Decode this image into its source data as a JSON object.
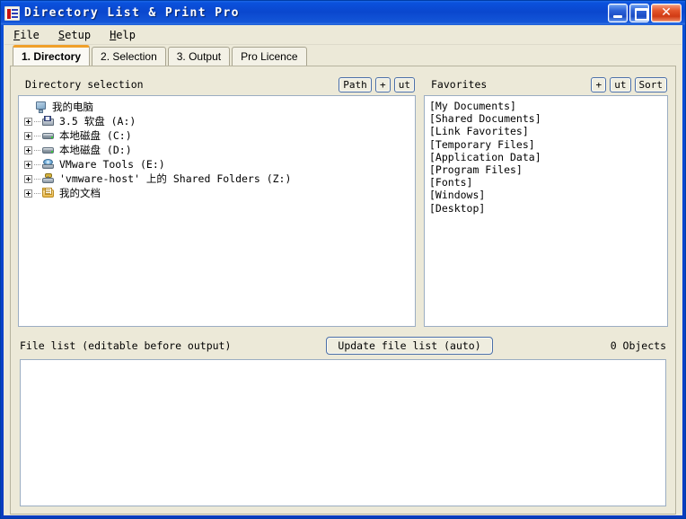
{
  "window": {
    "title": "Directory List & Print Pro",
    "icon": "app-list-icon",
    "minimize_label": "_",
    "maximize_label": "□",
    "close_label": "✕"
  },
  "menu": {
    "items": [
      {
        "accel": "F",
        "rest": "ile"
      },
      {
        "accel": "S",
        "rest": "etup"
      },
      {
        "accel": "H",
        "rest": "elp"
      }
    ]
  },
  "tabs": [
    {
      "label": "1. Directory",
      "active": true
    },
    {
      "label": "2. Selection",
      "active": false
    },
    {
      "label": "3. Output",
      "active": false
    },
    {
      "label": "Pro Licence",
      "active": false
    }
  ],
  "directory_panel": {
    "title": "Directory selection",
    "buttons": [
      {
        "label": "Path",
        "name": "path-button"
      },
      {
        "label": "+",
        "name": "add-button"
      },
      {
        "label": "ut",
        "name": "cut-button"
      }
    ],
    "tree": [
      {
        "label": "我的电脑",
        "icon": "computer-icon",
        "expander": false,
        "indent": 0
      },
      {
        "label": "3.5 软盘 (A:)",
        "icon": "floppy-icon",
        "expander": true,
        "indent": 1
      },
      {
        "label": "本地磁盘 (C:)",
        "icon": "hard-drive-icon",
        "expander": true,
        "indent": 1
      },
      {
        "label": "本地磁盘 (D:)",
        "icon": "hard-drive-icon",
        "expander": true,
        "indent": 1
      },
      {
        "label": "VMware Tools (E:)",
        "icon": "cd-drive-icon",
        "expander": true,
        "indent": 1
      },
      {
        "label": "'vmware-host' 上的 Shared Folders (Z:)",
        "icon": "network-drive-icon",
        "expander": true,
        "indent": 1
      },
      {
        "label": "我的文档",
        "icon": "folder-icon",
        "expander": true,
        "indent": 1
      }
    ]
  },
  "favorites_panel": {
    "title": "Favorites",
    "buttons": [
      {
        "label": "+",
        "name": "add-favorite-button"
      },
      {
        "label": "ut",
        "name": "cut-favorite-button"
      },
      {
        "label": "Sort",
        "name": "sort-favorites-button"
      }
    ],
    "items": [
      "[My Documents]",
      "[Shared Documents]",
      "[Link Favorites]",
      "[Temporary Files]",
      "[Application Data]",
      "[Program Files]",
      "[Fonts]",
      "[Windows]",
      "[Desktop]"
    ]
  },
  "file_list_section": {
    "label": "File list (editable before output)",
    "update_button": "Update file list (auto)",
    "object_count": "0 Objects",
    "content": ""
  },
  "colors": {
    "title_bar_blue": "#0a47ce",
    "client_beige": "#ece9d8",
    "active_tab_accent": "#f0a029",
    "button_border_blue": "#4a6fa8",
    "box_border": "#9badc2",
    "close_red": "#d03b14"
  }
}
